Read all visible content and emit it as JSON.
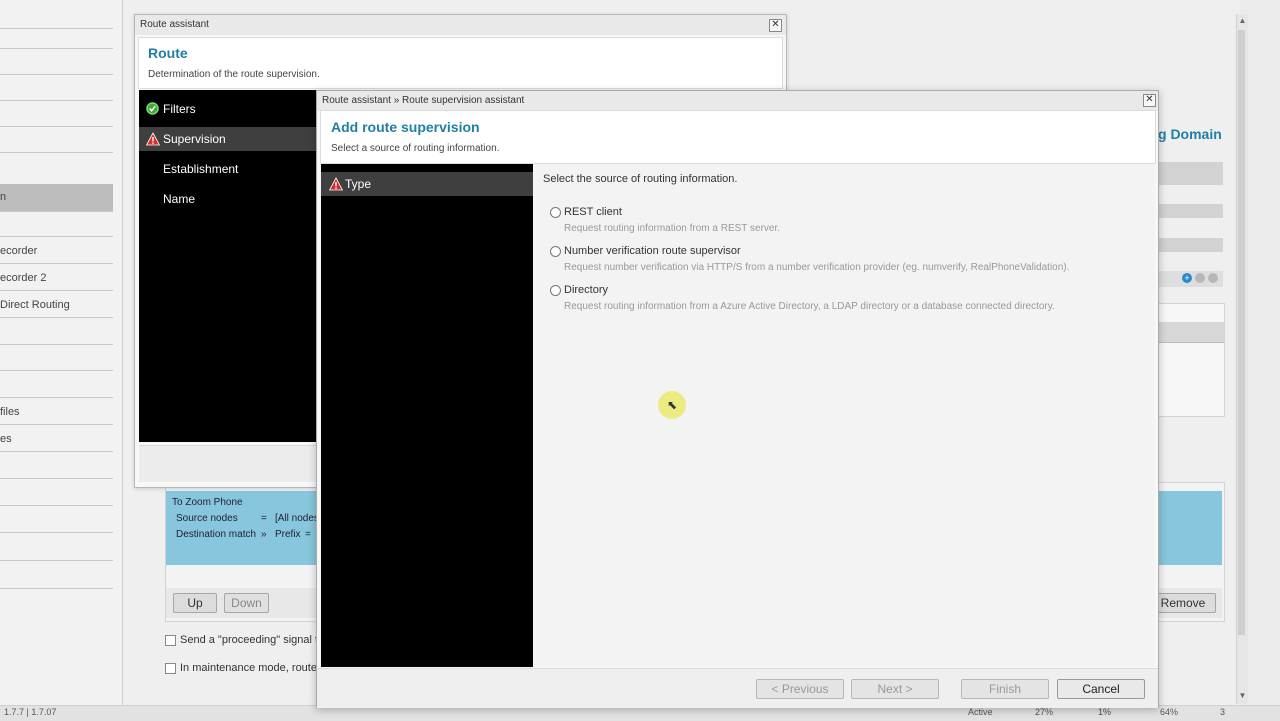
{
  "background": {
    "sidebar_items": [
      {
        "label": ""
      },
      {
        "label": ""
      },
      {
        "label": ""
      },
      {
        "label": ""
      },
      {
        "label": ""
      },
      {
        "label": ""
      },
      {
        "label": "n"
      },
      {
        "label": ""
      },
      {
        "label": "ecorder"
      },
      {
        "label": "ecorder 2"
      },
      {
        "label": "Direct Routing"
      },
      {
        "label": ""
      },
      {
        "label": ""
      },
      {
        "label": ""
      },
      {
        "label": "files"
      },
      {
        "label": "es"
      },
      {
        "label": ""
      },
      {
        "label": ""
      },
      {
        "label": ""
      },
      {
        "label": ""
      },
      {
        "label": ""
      }
    ],
    "right_title_partial": "g Domain",
    "route_entry": {
      "name": "To Zoom Phone",
      "line1_key": "Source nodes",
      "line1_op": "=",
      "line1_val": "[All nodes",
      "line2_key": "Destination match",
      "line2_op": "»",
      "line2_sub": "Prefix",
      "line2_eq": "="
    },
    "up_button": "Up",
    "down_button": "Down",
    "remove_button": "Remove",
    "option1": "Send a \"proceeding\" signal t",
    "option2": "In maintenance mode, route",
    "status_left": "1.7.7 | 1.7.07",
    "status_right": [
      "Active",
      "27%",
      "1%",
      "64%",
      "3"
    ]
  },
  "dialog_route": {
    "window_title": "Route assistant",
    "title": "Route",
    "subtitle": "Determination of the route supervision.",
    "steps": [
      {
        "label": "Filters",
        "state": "ok"
      },
      {
        "label": "Supervision",
        "state": "warning",
        "active": true
      },
      {
        "label": "Establishment",
        "state": "none"
      },
      {
        "label": "Name",
        "state": "none"
      }
    ]
  },
  "dialog_supervision": {
    "window_title": "Route assistant » Route supervision assistant",
    "title": "Add route supervision",
    "subtitle": "Select a source of routing information.",
    "steps": [
      {
        "label": "Type",
        "state": "warning",
        "active": true
      }
    ],
    "prompt": "Select the source of routing information.",
    "options": [
      {
        "label": "REST client",
        "description": "Request routing information from a REST server."
      },
      {
        "label": "Number verification route supervisor",
        "description": "Request number verification via HTTP/S from a number verification provider (eg. numverify, RealPhoneValidation)."
      },
      {
        "label": "Directory",
        "description": "Request routing information from a Azure Active Directory, a LDAP directory or a database connected directory."
      }
    ],
    "buttons": {
      "previous": "< Previous",
      "next": "Next >",
      "finish": "Finish",
      "cancel": "Cancel"
    }
  },
  "colors": {
    "accent": "#1f7fa6",
    "step_panel": "#000000",
    "warning": "#d32f2f",
    "ok": "#3ea83e",
    "route_entry": "#87c6dc"
  }
}
